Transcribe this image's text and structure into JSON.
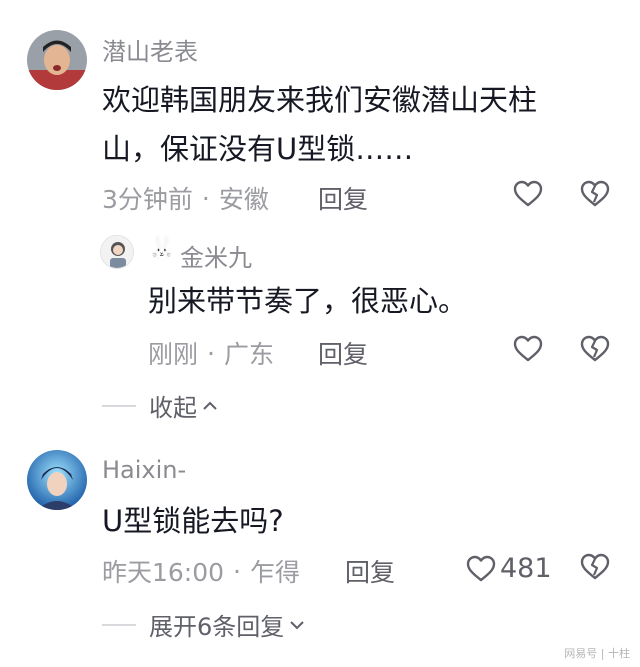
{
  "comments": [
    {
      "username": "潜山老表",
      "content_lines": [
        "欢迎韩国朋友来我们安徽潜山天柱",
        "山，保证没有U型锁……"
      ],
      "time": "3分钟前",
      "location": "安徽",
      "reply_label": "回复",
      "like_count": "",
      "replies": [
        {
          "badge": "🐰",
          "username": "金米九",
          "content": "别来带节奏了，很恶心。",
          "time": "刚刚",
          "location": "广东",
          "reply_label": "回复"
        }
      ],
      "collapse_label": "收起"
    },
    {
      "username": "Haixin-",
      "content": "U型锁能去吗?",
      "time": "昨天16:00",
      "location": "乍得",
      "reply_label": "回复",
      "like_count": "481",
      "expand_label": "展开6条回复"
    }
  ],
  "separator": "·",
  "watermark": "网易号 | 十柱",
  "colors": {
    "text_primary": "#161823",
    "text_secondary": "#9b9ca1",
    "username": "#8a8b91",
    "icon": "#5f6068"
  },
  "icons": [
    "heart-outline-icon",
    "broken-heart-icon",
    "chevron-up-icon",
    "chevron-down-icon",
    "rabbit-badge-icon"
  ]
}
